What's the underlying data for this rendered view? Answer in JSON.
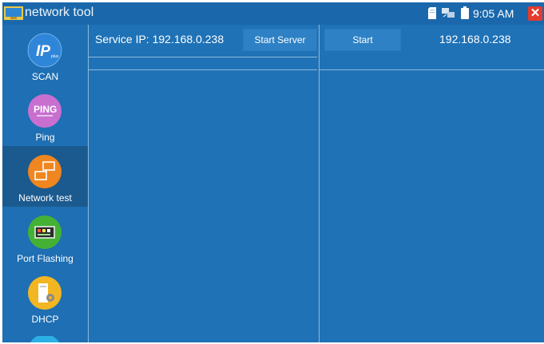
{
  "titlebar": {
    "title": "network tool",
    "time": "9:05 AM",
    "close_glyph": "✕",
    "icons": [
      "app-icon",
      "sd-card-icon",
      "network-icon",
      "battery-icon",
      "close-icon"
    ]
  },
  "sidebar": {
    "items": [
      {
        "label": "SCAN",
        "icon": "ip-scan-icon",
        "color": "#3a8fe0",
        "active": false
      },
      {
        "label": "Ping",
        "icon": "ping-icon",
        "color": "#c86fd0",
        "active": false
      },
      {
        "label": "Network test",
        "icon": "network-test-icon",
        "color": "#f0861f",
        "active": true
      },
      {
        "label": "Port Flashing",
        "icon": "port-flashing-icon",
        "color": "#44b135",
        "active": false
      },
      {
        "label": "DHCP",
        "icon": "dhcp-icon",
        "color": "#f2b622",
        "active": false
      }
    ]
  },
  "server_panel": {
    "service_ip": "Service IP: 192.168.0.238",
    "start_server_label": "Start Server"
  },
  "client_panel": {
    "start_label": "Start",
    "target_ip": "192.168.0.238"
  },
  "colors": {
    "background": "#1f72b6",
    "titlebar": "#1a68ab",
    "active_item": "#1b5a8f",
    "divider": "#8db8dc"
  }
}
